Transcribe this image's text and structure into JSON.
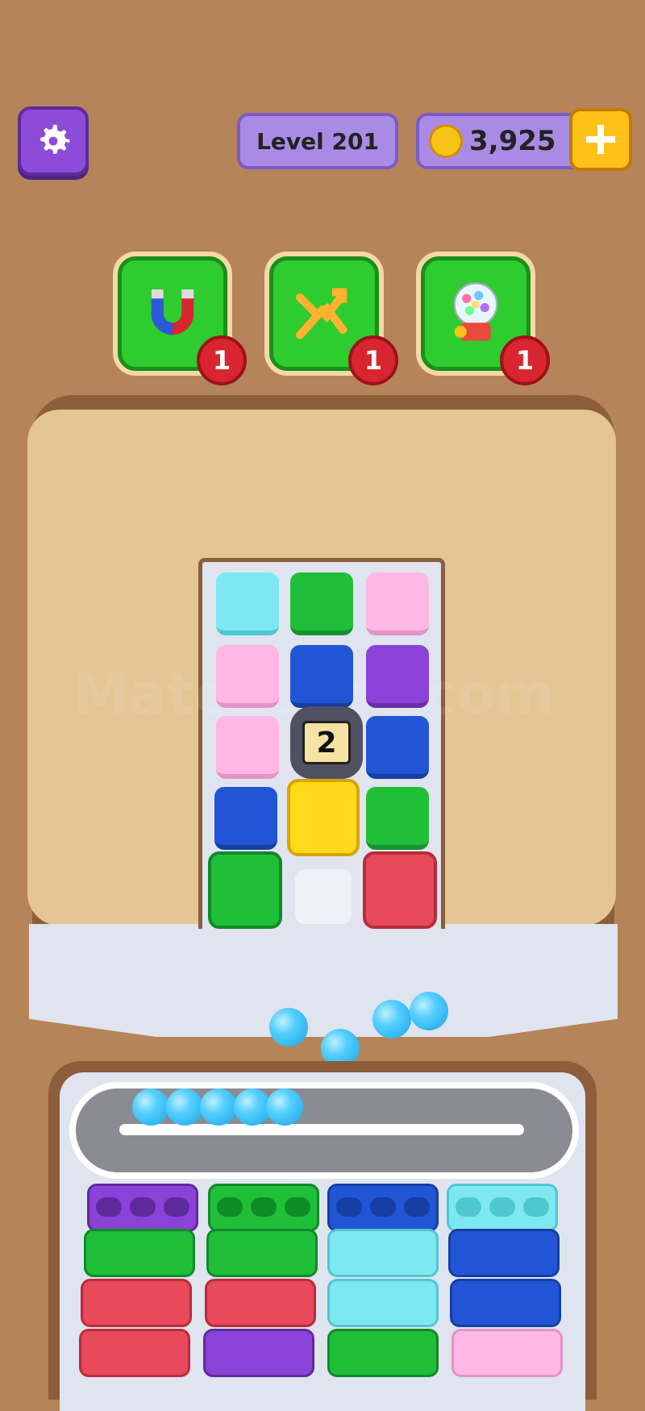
{
  "header": {
    "level_label": "Level 201",
    "coins": "3,925"
  },
  "boosters": [
    {
      "name": "magnet",
      "count": "1"
    },
    {
      "name": "shuffle",
      "count": "1"
    },
    {
      "name": "gumball",
      "count": "1"
    }
  ],
  "watermark": "MatchSort.com",
  "locked_tile_number": "2",
  "colors": {
    "cyan": "#7ee8f0",
    "green": "#1fbf3a",
    "pink": "#ffb8e6",
    "blue": "#2255d6",
    "purple": "#8b42d8",
    "yellow": "#ffd91a",
    "red": "#e84a5b"
  }
}
